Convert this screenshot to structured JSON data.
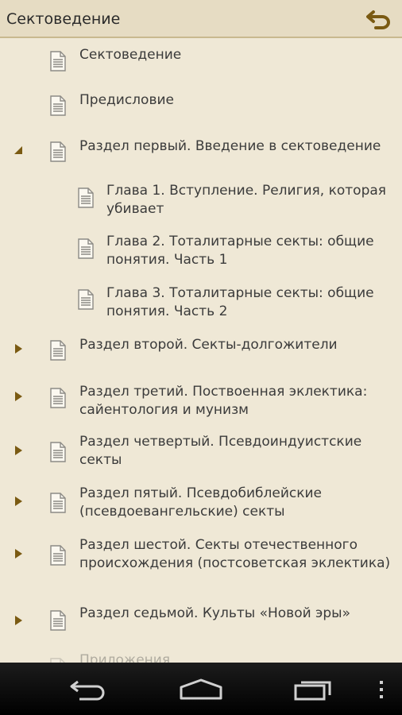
{
  "header": {
    "title": "Сектоведение"
  },
  "items": [
    {
      "label": "Сектоведение",
      "expander": "none"
    },
    {
      "label": "Предисловие",
      "expander": "none"
    },
    {
      "label": "Раздел первый. Введение в сектоведение",
      "expander": "expanded"
    },
    {
      "label": "Глава 1. Вступление. Религия, которая убивает",
      "expander": "none"
    },
    {
      "label": "Глава 2. Тоталитарные секты: общие понятия. Часть 1",
      "expander": "none"
    },
    {
      "label": "Глава 3. Тоталитарные секты: общие понятия. Часть 2",
      "expander": "none"
    },
    {
      "label": "Раздел второй. Секты-долгожители",
      "expander": "collapsed"
    },
    {
      "label": "Раздел третий. Поствоенная эклектика: сайентология и мунизм",
      "expander": "collapsed"
    },
    {
      "label": "Раздел четвертый. Псевдоиндуистские секты",
      "expander": "collapsed"
    },
    {
      "label": "Раздел пятый. Псевдобиблейские (псевдоевангельские) секты",
      "expander": "collapsed"
    },
    {
      "label": "Раздел шестой. Секты отечественного происхождения (постсоветская эклектика)",
      "expander": "collapsed"
    },
    {
      "label": "Раздел седьмой. Культы «Новой эры»",
      "expander": "collapsed"
    },
    {
      "label": "Приложения",
      "expander": "none"
    }
  ],
  "colors": {
    "background": "#efe8d6",
    "header": "#e6dcc3",
    "accent": "#7a5a12",
    "navbar": "#000000"
  }
}
